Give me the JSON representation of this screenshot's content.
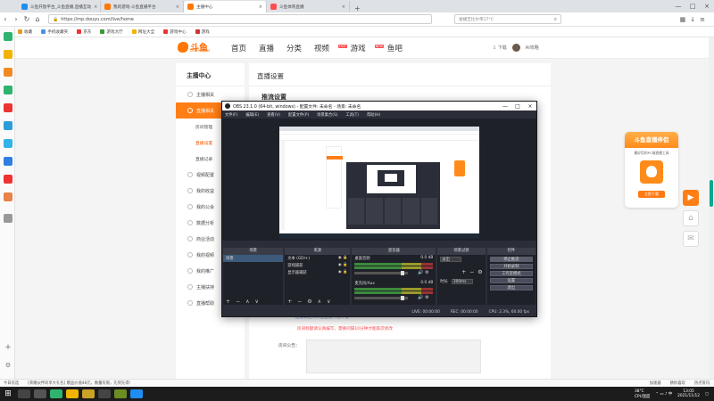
{
  "tabs": [
    {
      "title": "斗鱼开放平台_斗鱼直播,直播互动",
      "fav": "#1f8ef1",
      "active": false
    },
    {
      "title": "我的游戏-斗鱼直播平台",
      "fav": "#ff7700",
      "active": false
    },
    {
      "title": "主播中心",
      "fav": "#ff7700",
      "active": true
    },
    {
      "title": "斗鱼体育直播",
      "fav": "#ff4d4f",
      "active": false
    }
  ],
  "address": {
    "url": "https://mp.douyu.com/live/home",
    "search_placeholder": "速播吉比尔带17°C"
  },
  "bookmarks": [
    {
      "label": "收藏"
    },
    {
      "label": "手机收藏夹"
    },
    {
      "label": "京东"
    },
    {
      "label": "游戏大厅"
    },
    {
      "label": "网址大全"
    },
    {
      "label": "游戏中心"
    },
    {
      "label": "游戏"
    }
  ],
  "header": {
    "logo_text": "斗鱼",
    "logo_sub": "DOUYU.COM",
    "nav": [
      "首页",
      "直播",
      "分类",
      "视频",
      "游戏",
      "鱼吧"
    ],
    "hot_badges": {
      "视频": "HOT",
      "游戏": "NEW"
    },
    "download": "下载",
    "username": "AI攻略"
  },
  "sidenav": {
    "heading": "主播中心",
    "items": [
      {
        "label": "主播相关",
        "type": "item",
        "active": false
      },
      {
        "label": "直播相关",
        "type": "item",
        "active": true
      },
      {
        "label": "房间管理",
        "type": "sub",
        "active": false
      },
      {
        "label": "直播设置",
        "type": "sub",
        "active": true
      },
      {
        "label": "直播记录",
        "type": "sub",
        "active": false
      },
      {
        "label": "视频配置",
        "type": "item",
        "active": false
      },
      {
        "label": "我的收益",
        "type": "item",
        "active": false
      },
      {
        "label": "我的公会",
        "type": "item",
        "active": false
      },
      {
        "label": "数据分析",
        "type": "item",
        "active": false
      },
      {
        "label": "商业活动",
        "type": "item",
        "active": false
      },
      {
        "label": "我的视频",
        "type": "item",
        "active": false
      },
      {
        "label": "我的推广",
        "type": "item",
        "active": false
      },
      {
        "label": "主播扶持",
        "type": "item",
        "active": false
      },
      {
        "label": "直播帮助",
        "type": "item",
        "active": false
      }
    ]
  },
  "content": {
    "title": "直播设置",
    "subtitle": "推流设置",
    "blue_text": "后续请使用斗鱼直播伴侣开播",
    "red_note": "房间标题请认真编写，需要间隔10分钟才能再次修改",
    "notice_label": "房间公告："
  },
  "promo": {
    "title": "斗鱼直播伴侣",
    "desc": "最好用的PC端直播工具",
    "button": "立即下载"
  },
  "obs": {
    "title": "OBS 23.1.0 (64-bit, windows) - 配置文件: 未命名 - 场景: 未命名",
    "menu": [
      "文件(F)",
      "编辑(E)",
      "查看(V)",
      "配置文件(P)",
      "场景集合(S)",
      "工具(T)",
      "帮助(H)"
    ],
    "docks": {
      "scenes": {
        "header": "场景",
        "items": [
          "场景"
        ]
      },
      "sources": {
        "header": "来源",
        "items": [
          "文本 (GDI+)",
          "游戏捕获",
          "显示器捕获"
        ]
      },
      "mixer": {
        "header": "混音器",
        "channels": [
          {
            "name": "桌面音频",
            "level": "0.0 dB"
          },
          {
            "name": "麦克风/Aux",
            "level": "0.0 dB"
          }
        ]
      },
      "transitions": {
        "header": "场景过渡",
        "mode": "淡出",
        "duration_label": "时长",
        "duration": "300ms"
      },
      "controls": {
        "header": "控件",
        "buttons": [
          "停止推流",
          "开始录制",
          "工作室模式",
          "设置",
          "退出"
        ]
      }
    },
    "status": {
      "live": "LIVE: 00:00:00",
      "rec": "REC: 00:00:00",
      "cpu": "CPU: 2.3%, 60.00 fps"
    }
  },
  "browser_status": {
    "left": "今日优选",
    "news": "[荣耀伙伴同享大礼包] 赠品价值48元，数量有限，先到先得!",
    "right": [
      "加速器",
      "猜你喜欢",
      "热点资讯"
    ]
  },
  "taskbar": {
    "temp": "38°C",
    "cpu": "CPU温度",
    "time": "13:05",
    "date": "2021/11/12"
  },
  "colors": {
    "accent": "#ff7e16",
    "obs_bg": "#2b2e38",
    "teal": "#0aa88f"
  }
}
